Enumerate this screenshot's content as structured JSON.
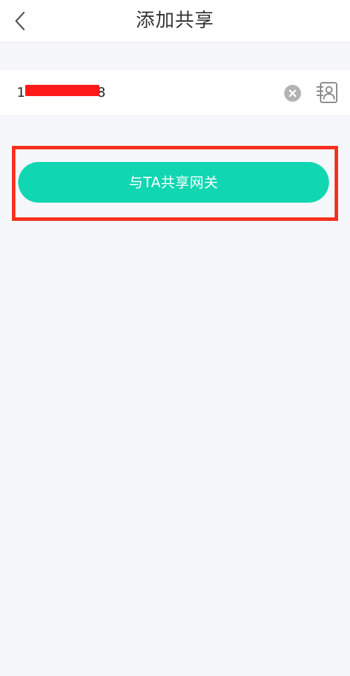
{
  "header": {
    "title": "添加共享",
    "back_icon": "chevron-left-icon"
  },
  "form": {
    "phone_value": "1                 8",
    "clear_icon": "clear-circle-icon",
    "contacts_icon": "contacts-book-icon"
  },
  "actions": {
    "share_label": "与TA共享网关"
  },
  "colors": {
    "page_bg": "#f6f7fb",
    "header_bg": "#ffffff",
    "accent": "#10d6b2",
    "highlight": "#f5301e",
    "redaction": "#ff1a1a",
    "clear_icon_bg": "#b3b3b3",
    "icon_gray": "#8a8a8a"
  }
}
